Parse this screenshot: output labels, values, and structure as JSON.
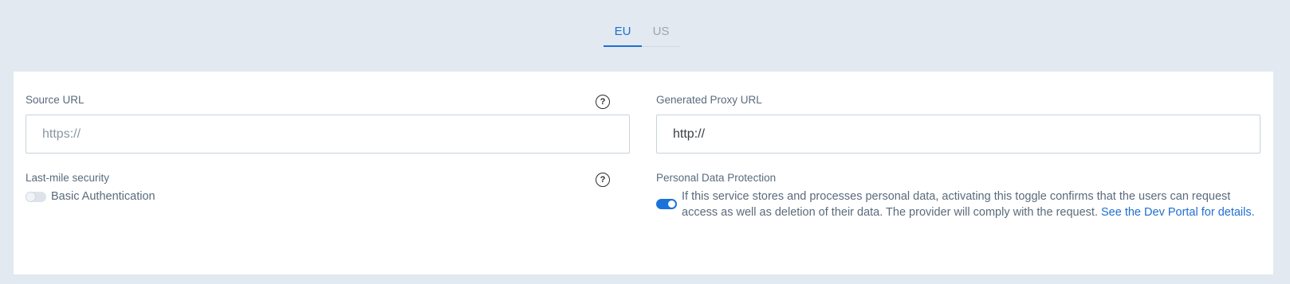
{
  "tabs": [
    {
      "label": "EU",
      "active": true
    },
    {
      "label": "US",
      "active": false
    }
  ],
  "source_url": {
    "label": "Source URL",
    "placeholder": "https://",
    "help_icon": "question-circle-icon"
  },
  "proxy_url": {
    "label": "Generated Proxy URL",
    "value": "http://"
  },
  "last_mile": {
    "label": "Last-mile security",
    "toggle_label": "Basic Authentication",
    "toggle_on": false,
    "help_icon": "question-circle-icon"
  },
  "data_protection": {
    "label": "Personal Data Protection",
    "text_line1": "If this service stores and processes personal data, activating this toggle confirms that the users can request",
    "text_line2": "access as well as deletion of their data. The provider will comply with the request. ",
    "link_text": "See the Dev Portal for details.",
    "toggle_on": true
  },
  "colors": {
    "accent": "#1f6fd0",
    "background": "#e2e9f0",
    "panel": "#ffffff"
  }
}
